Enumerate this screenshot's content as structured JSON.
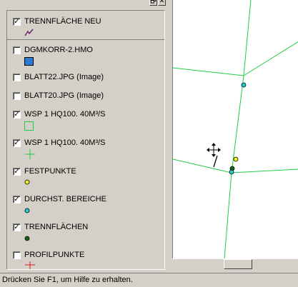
{
  "window_buttons": {
    "restore": "🗗",
    "close": "✕"
  },
  "legend": {
    "layers": [
      {
        "label": "TRENNFLÄCHE NEU",
        "checked": true,
        "symbol": "purple-line-icon"
      },
      {
        "label": "DGMKORR-2.HMO",
        "checked": false,
        "symbol": "blue-square-icon"
      },
      {
        "label": "BLATT22.JPG (Image)",
        "checked": false
      },
      {
        "label": "BLATT20.JPG (Image)",
        "checked": false
      },
      {
        "label": "WSP 1 HQ100. 40M³/S",
        "checked": true,
        "symbol": "green-square-outline-icon"
      },
      {
        "label": "WSP 1 HQ100. 40M³/S",
        "checked": true,
        "symbol": "green-cross-icon"
      },
      {
        "label": "FESTPUNKTE",
        "checked": true,
        "symbol": "yellow-dot-icon"
      },
      {
        "label": "DURCHST. BEREICHE",
        "checked": true,
        "symbol": "cyan-dot-icon"
      },
      {
        "label": "TRENNFLÄCHEN",
        "checked": true,
        "symbol": "darkgreen-dot-icon"
      },
      {
        "label": "PROFILPUNKTE",
        "checked": false,
        "symbol": "red-cross-icon"
      }
    ],
    "check_glyph": "✓",
    "scroll_up": "⇧",
    "scroll_down": "▼"
  },
  "colors": {
    "line_green": "#22cc44",
    "point_cyan": "#22cccc",
    "point_yellow": "#eeee22",
    "point_darkgreen": "#116611",
    "purple": "#6a1a6a",
    "blue": "#2a7ad6",
    "red": "#dd2222"
  },
  "status": {
    "text": "Drücken Sie F1, um Hilfe zu erhalten."
  }
}
